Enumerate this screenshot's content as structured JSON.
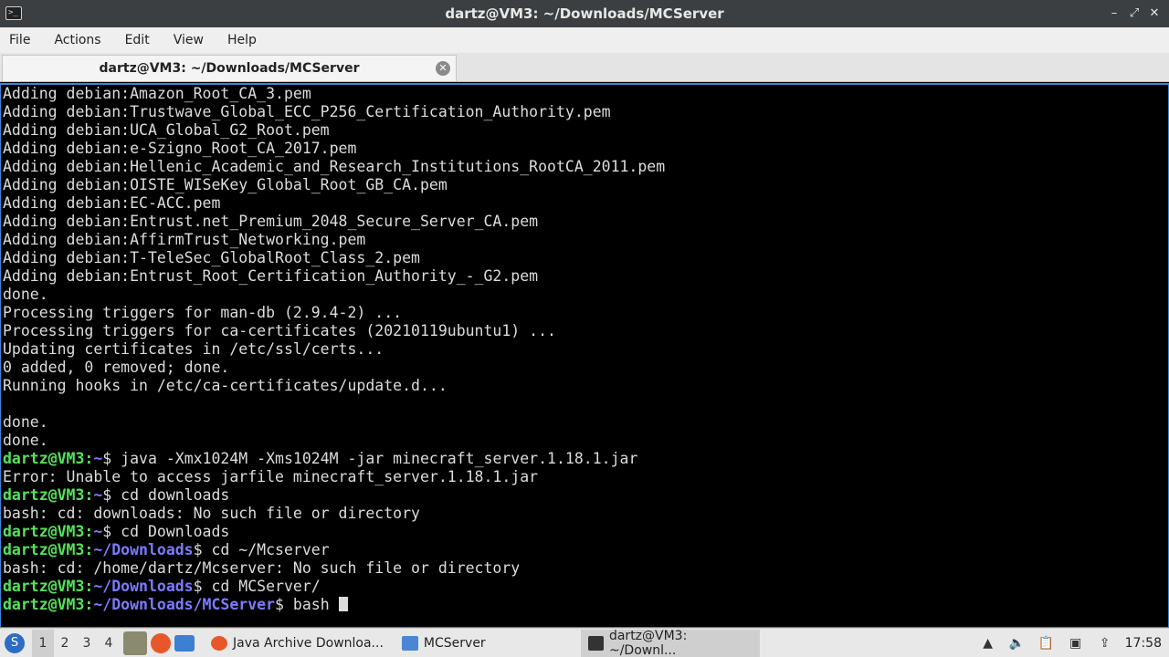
{
  "window": {
    "title": "dartz@VM3: ~/Downloads/MCServer",
    "app_icon": ">_",
    "minimize": "–",
    "maximize": "⤢",
    "close": "✕"
  },
  "menu": [
    "File",
    "Actions",
    "Edit",
    "View",
    "Help"
  ],
  "tab": {
    "label": "dartz@VM3: ~/Downloads/MCServer",
    "close": "✕"
  },
  "terminal": {
    "lines": [
      "Adding debian:Amazon_Root_CA_3.pem",
      "Adding debian:Trustwave_Global_ECC_P256_Certification_Authority.pem",
      "Adding debian:UCA_Global_G2_Root.pem",
      "Adding debian:e-Szigno_Root_CA_2017.pem",
      "Adding debian:Hellenic_Academic_and_Research_Institutions_RootCA_2011.pem",
      "Adding debian:OISTE_WISeKey_Global_Root_GB_CA.pem",
      "Adding debian:EC-ACC.pem",
      "Adding debian:Entrust.net_Premium_2048_Secure_Server_CA.pem",
      "Adding debian:AffirmTrust_Networking.pem",
      "Adding debian:T-TeleSec_GlobalRoot_Class_2.pem",
      "Adding debian:Entrust_Root_Certification_Authority_-_G2.pem",
      "done.",
      "Processing triggers for man-db (2.9.4-2) ...",
      "Processing triggers for ca-certificates (20210119ubuntu1) ...",
      "Updating certificates in /etc/ssl/certs...",
      "0 added, 0 removed; done.",
      "Running hooks in /etc/ca-certificates/update.d...",
      "",
      "done.",
      "done."
    ],
    "prompt_user": "dartz@VM3",
    "session": [
      {
        "path": "~",
        "cmd": " java -Xmx1024M -Xms1024M -jar minecraft_server.1.18.1.jar"
      },
      {
        "out": "Error: Unable to access jarfile minecraft_server.1.18.1.jar"
      },
      {
        "path": "~",
        "cmd": " cd downloads"
      },
      {
        "out": "bash: cd: downloads: No such file or directory"
      },
      {
        "path": "~",
        "cmd": " cd Downloads"
      },
      {
        "path": "~/Downloads",
        "cmd": " cd ~/Mcserver"
      },
      {
        "out": "bash: cd: /home/dartz/Mcserver: No such file or directory"
      },
      {
        "path": "~/Downloads",
        "cmd": " cd MCServer/"
      },
      {
        "path": "~/Downloads/MCServer",
        "cmd": " bash "
      }
    ]
  },
  "taskbar": {
    "start_icon": "start-menu-icon",
    "workspaces": [
      "1",
      "2",
      "3",
      "4"
    ],
    "active_workspace": "1",
    "tasks": [
      {
        "label": "Java Archive Downloa...",
        "icon": "firefox-icon",
        "color": "#e8572a"
      },
      {
        "label": "MCServer",
        "icon": "folder-icon",
        "color": "#4a86d4"
      },
      {
        "label": "dartz@VM3: ~/Downl...",
        "icon": "terminal-icon",
        "color": "#333333"
      }
    ],
    "clock": "17:58"
  },
  "colors": {
    "prompt_user": "#54e35a",
    "prompt_path": "#7b7bff",
    "accent": "#3a86d8"
  }
}
